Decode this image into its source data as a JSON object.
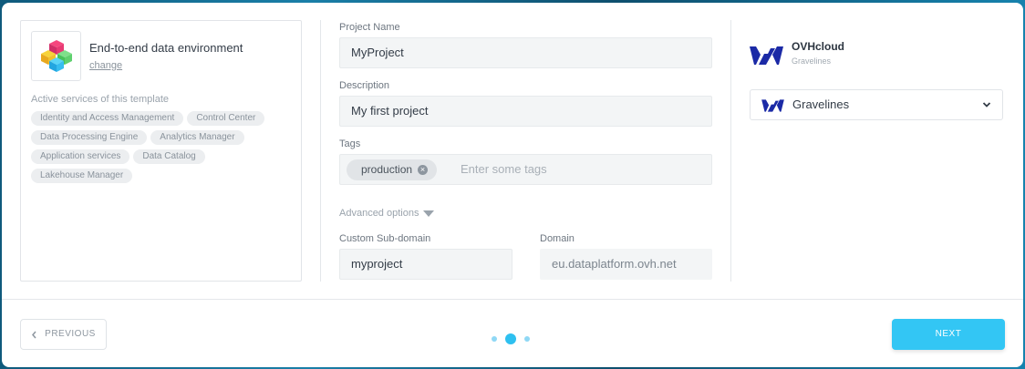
{
  "template": {
    "title": "End-to-end data environment",
    "change_label": "change",
    "services_heading": "Active services of this template",
    "services": [
      "Identity and Access Management",
      "Control Center",
      "Data Processing Engine",
      "Analytics Manager",
      "Application services",
      "Data Catalog",
      "Lakehouse Manager"
    ]
  },
  "form": {
    "project_name_label": "Project Name",
    "project_name_value": "MyProject",
    "description_label": "Description",
    "description_value": "My first project",
    "tags_label": "Tags",
    "tags": [
      "production"
    ],
    "tags_placeholder": "Enter some tags",
    "advanced_label": "Advanced options",
    "subdomain_label": "Custom Sub-domain",
    "subdomain_value": "myproject",
    "domain_label": "Domain",
    "domain_value": "eu.dataplatform.ovh.net"
  },
  "provider": {
    "name": "OVHcloud",
    "region_sub": "Gravelines",
    "selected_region": "Gravelines"
  },
  "footer": {
    "previous_label": "PREVIOUS",
    "next_label": "NEXT",
    "steps_total": 3,
    "current_step": 2
  },
  "colors": {
    "accent": "#33c6f4",
    "ovh_blue": "#1b2aa6"
  },
  "icons": [
    "data-cubes-icon",
    "tag-remove-icon",
    "caret-down-icon",
    "ovhcloud-logo-icon",
    "chevron-down-icon",
    "chevron-left-icon"
  ]
}
